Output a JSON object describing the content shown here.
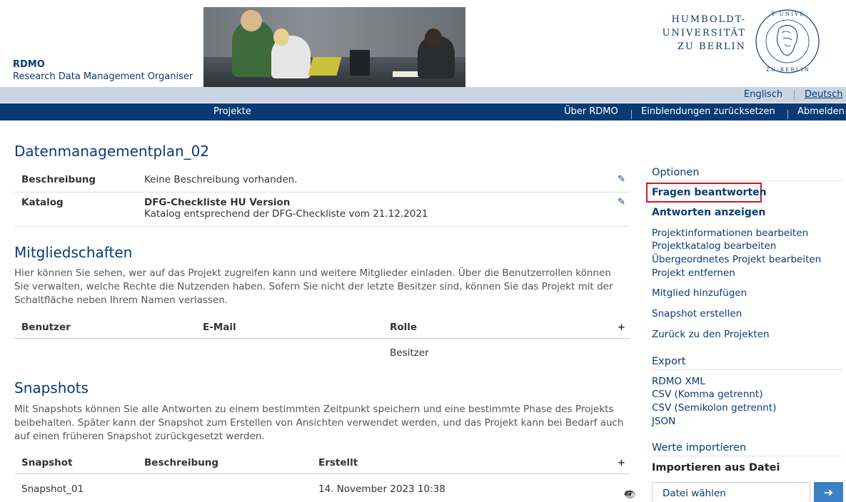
{
  "brand": {
    "title": "RDMO",
    "subtitle": "Research Data Management Organiser"
  },
  "university": {
    "line1": "HUMBOLDT-",
    "line2": "UNIVERSITÄT",
    "line3": "ZU BERLIN"
  },
  "languages": {
    "english": "Englisch",
    "german": "Deutsch"
  },
  "nav": {
    "projects": "Projekte",
    "about": "Über RDMO",
    "reset": "Einblendungen zurücksetzen",
    "logout": "Abmelden"
  },
  "project": {
    "title": "Datenmanagementplan_02",
    "description_label": "Beschreibung",
    "description_value": "Keine Beschreibung vorhanden.",
    "catalog_label": "Katalog",
    "catalog_name": "DFG-Checkliste HU Version",
    "catalog_desc": "Katalog entsprechend der DFG-Checkliste vom 21.12.2021"
  },
  "memberships": {
    "title": "Mitgliedschaften",
    "text": "Hier können Sie sehen, wer auf das Projekt zugreifen kann und weitere Mitglieder einladen. Über die Benutzerrollen können Sie verwalten, welche Rechte die Nutzenden haben. Sofern Sie nicht der letzte Besitzer sind, können Sie das Projekt mit der Schaltfläche neben Ihrem Namen verlassen.",
    "col_user": "Benutzer",
    "col_email": "E-Mail",
    "col_role": "Rolle",
    "rows": [
      {
        "user": "",
        "email": "",
        "role": "Besitzer"
      }
    ]
  },
  "snapshots": {
    "title": "Snapshots",
    "text": "Mit Snapshots können Sie alle Antworten zu einem bestimmten Zeitpunkt speichern und eine bestimmte Phase des Projekts beibehalten. Später kann der Snapshot zum Erstellen von Ansichten verwendet werden, und das Projekt kann bei Bedarf auch auf einen früheren Snapshot zurückgesetzt werden.",
    "col_snapshot": "Snapshot",
    "col_desc": "Beschreibung",
    "col_created": "Erstellt",
    "rows": [
      {
        "name": "Snapshot_01",
        "desc": "",
        "created": "14. November 2023 10:38"
      }
    ]
  },
  "sidebar": {
    "options_title": "Optionen",
    "answer_questions": "Fragen beantworten",
    "show_answers": "Antworten anzeigen",
    "edit_info": "Projektinformationen bearbeiten",
    "edit_catalog": "Projektkatalog bearbeiten",
    "edit_parent": "Übergeordnetes Projekt bearbeiten",
    "remove_project": "Projekt entfernen",
    "add_member": "Mitglied hinzufügen",
    "create_snapshot": "Snapshot erstellen",
    "back_to_projects": "Zurück zu den Projekten",
    "export_title": "Export",
    "export_xml": "RDMO XML",
    "export_csv_comma": "CSV (Komma getrennt)",
    "export_csv_semicolon": "CSV (Semikolon getrennt)",
    "export_json": "JSON",
    "import_title": "Werte importieren",
    "import_file_title": "Importieren aus Datei",
    "file_choose": "Datei wählen"
  },
  "colors": {
    "primary": "#0a3a73",
    "lang_bar": "#c9d4e3",
    "highlight": "#d0181e",
    "button": "#3c80c6"
  },
  "icons": [
    "pencil-icon",
    "plus-icon",
    "eye-icon",
    "undo-icon",
    "arrow-right-icon",
    "hu-seal-icon"
  ]
}
